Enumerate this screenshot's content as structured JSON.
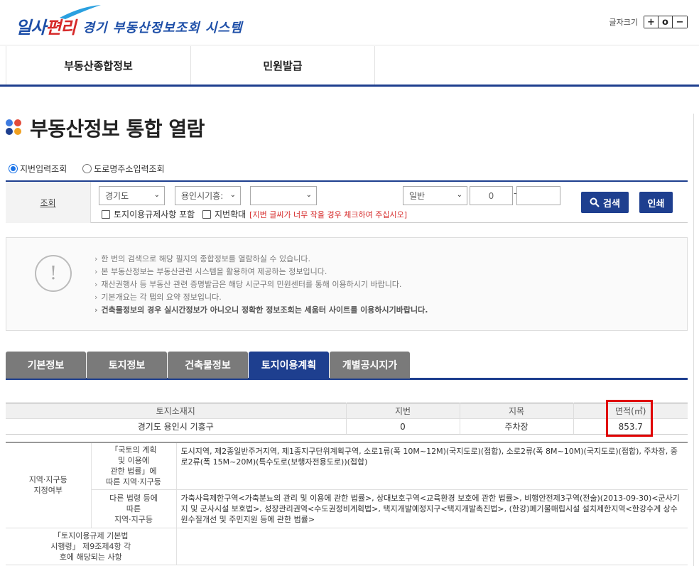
{
  "header": {
    "logo_brand_a": "일사",
    "logo_brand_b": "편리",
    "logo_title": "경기 부동산정보조회 시스템",
    "fontsize_label": "글자크기",
    "fontsize_buttons": [
      "+",
      "o",
      "−"
    ]
  },
  "nav": {
    "items": [
      "부동산종합정보",
      "민원발급"
    ]
  },
  "page": {
    "title": "부동산정보 통합 열람"
  },
  "search": {
    "radio_lot": "지번입력조회",
    "radio_road": "도로명주소입력조회",
    "label": "조회",
    "sido": "경기도",
    "sigungu": "용인시기흥:",
    "dong": "",
    "type": "일반",
    "main_no": "0",
    "separator": "-",
    "sub_no": "",
    "chk_regulation": "토지이용규제사항 포함",
    "chk_zoom": "지번확대",
    "zoom_warning": "[지번 글씨가 너무 작을 경우 체크하여 주십시오]",
    "btn_search": "검색",
    "btn_print": "인쇄"
  },
  "notice": {
    "icon": "!",
    "items": [
      "한 번의 검색으로 해당 필지의 종합정보를 열람하실 수 있습니다.",
      "본 부동산정보는 부동산관련 시스템을 활용하여 제공하는 정보입니다.",
      "재산권행사 등 부동산 관련 증명발급은 해당 시군구의 민원센터를 통해 이용하시기 바랍니다.",
      "기본개요는 각 탭의 요약 정보입니다.",
      "건축물정보의 경우 실시간정보가 아니오니 정확한 정보조회는 세움터 사이트를 이용하시기바랍니다."
    ]
  },
  "tabs": [
    "기본정보",
    "토지정보",
    "건축물정보",
    "토지이용계획",
    "개별공시지가"
  ],
  "land_table": {
    "headers": [
      "토지소재지",
      "지번",
      "지목",
      "면적(㎡)"
    ],
    "row": [
      "경기도 용인시 기흥구",
      "0",
      "주차장",
      "853.7"
    ]
  },
  "zoning": {
    "group_label": "지역·지구등\n지정여부",
    "row1_label": "「국토의 계획\n및 이용에\n관한 법률」에\n따른 지역·지구등",
    "row1_content": "도시지역, 제2종일반주거지역, 제1종지구단위계획구역, 소로1류(폭 10M~12M)(국지도로)(접합), 소로2류(폭 8M~10M)(국지도로)(접합), 주차장, 중로2류(폭 15M~20M)(특수도로(보행자전용도로))(접합)",
    "row2_label": "다른 법령 등에\n따른\n지역·지구등",
    "row2_content": "가축사육제한구역<가축분뇨의 관리 및 이용에 관한 법률>, 상대보호구역<교육환경 보호에 관한 법률>, 비행안전제3구역(전술)(2013-09-30)<군사기지 및 군사시설 보호법>, 성장관리권역<수도권정비계획법>, 택지개발예정지구<택지개발촉진법>, (한강)폐기물매립시설 설치제한지역<한강수계 상수원수질개선 및 주민지원 등에 관한 법률>",
    "row3_label": "「토지이용규제 기본법\n시행령」 제9조제4항 각\n호에 해당되는 사항",
    "row3_content": ""
  },
  "colors": {
    "brand_blue": "#1e4fa8",
    "navy": "#1e3f8f",
    "tab_gray": "#7a7a7a",
    "highlight_red": "#e00000",
    "dot_blue": "#3d7be0",
    "dot_red": "#e24b3b",
    "dot_darkblue": "#1e3f8f",
    "dot_orange": "#f0a020"
  }
}
